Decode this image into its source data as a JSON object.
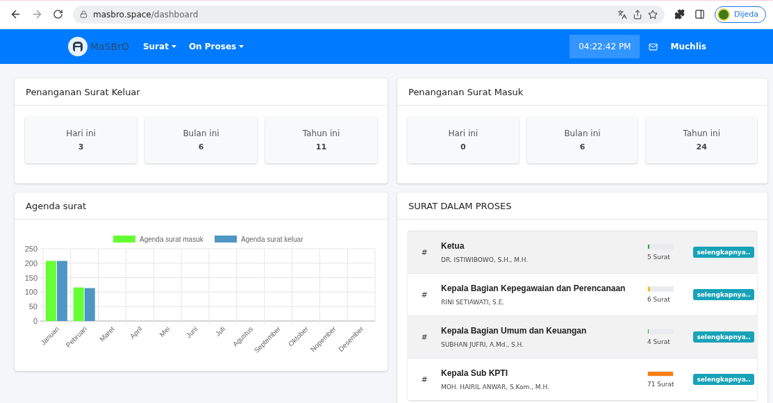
{
  "browser": {
    "url_host": "masbro.space",
    "url_path": "/dashboard",
    "profile": "Dijeda"
  },
  "navbar": {
    "brand": "MaSBrO",
    "menus": [
      "Surat",
      "On Proses"
    ],
    "clock": "04:22:42 PM",
    "user": "Muchlis"
  },
  "summary_cards": [
    {
      "title": "Penanganan Surat Keluar",
      "stats": [
        {
          "label": "Hari ini",
          "value": "3"
        },
        {
          "label": "Bulan ini",
          "value": "6"
        },
        {
          "label": "Tahun ini",
          "value": "11"
        }
      ]
    },
    {
      "title": "Penanganan Surat Masuk",
      "stats": [
        {
          "label": "Hari ini",
          "value": "0"
        },
        {
          "label": "Bulan ini",
          "value": "6"
        },
        {
          "label": "Tahun ini",
          "value": "24"
        }
      ]
    }
  ],
  "agenda": {
    "title": "Agenda surat",
    "chart_data": {
      "type": "bar",
      "categories": [
        "Januari",
        "Pebruari",
        "Maret",
        "April",
        "Mei",
        "Juni",
        "Juli",
        "Agustus",
        "September",
        "Oktober",
        "Nopember",
        "Desember"
      ],
      "series": [
        {
          "name": "Agenda surat masuk",
          "color": "#66ff33",
          "values": [
            208,
            116,
            0,
            0,
            0,
            0,
            0,
            0,
            0,
            0,
            0,
            0
          ]
        },
        {
          "name": "Agenda surat keluar",
          "color": "#4e97c4",
          "values": [
            208,
            114,
            0,
            0,
            0,
            0,
            0,
            0,
            0,
            0,
            0,
            0
          ]
        }
      ],
      "ylim": [
        0,
        250
      ],
      "yticks": [
        0,
        50,
        100,
        150,
        200,
        250
      ],
      "grid": true,
      "legend": true
    }
  },
  "proses": {
    "title": "SURAT DALAM PROSES",
    "rows": [
      {
        "marker": "#",
        "title": "Ketua",
        "name": "DR. ISTIWIBOWO, S.H., M.H.",
        "count": "5 Surat",
        "level": 0.05,
        "color": "#28a745",
        "action": "selengkapnya.."
      },
      {
        "marker": "#",
        "title": "Kepala Bagian Kepegawaian dan Perencanaan",
        "name": "RINI SETIAWATI, S.E.",
        "count": "6 Surat",
        "level": 0.08,
        "color": "#ffc107",
        "action": "selengkapnya.."
      },
      {
        "marker": "#",
        "title": "Kepala Bagian Umum dan Keuangan",
        "name": "SUBHAN JUFRI, A.Md., S.H.",
        "count": "4 Surat",
        "level": 0.04,
        "color": "#28a745",
        "action": "selengkapnya.."
      },
      {
        "marker": "#",
        "title": "Kepala Sub KPTI",
        "name": "MOH. HAIRIL ANWAR, S.Kom., M.H.",
        "count": "71 Surat",
        "level": 1,
        "color": "#fd7e14",
        "action": "selengkapnya.."
      }
    ]
  }
}
